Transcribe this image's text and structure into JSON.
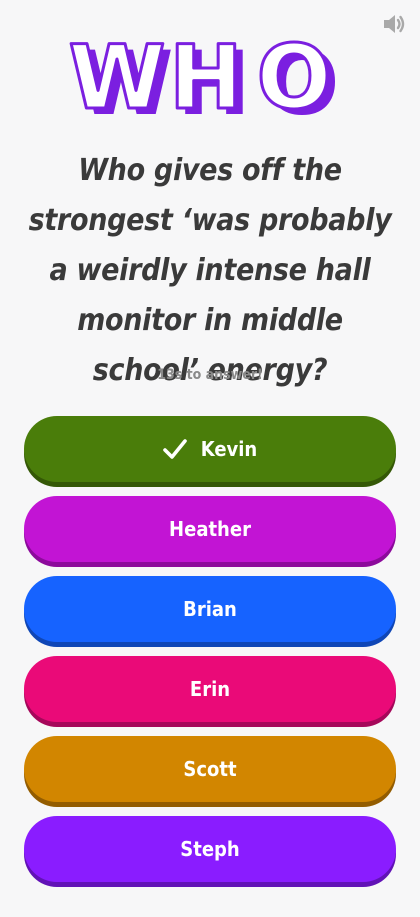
{
  "header": {
    "sound_icon": "speaker-icon",
    "logo_letters": [
      "W",
      "H",
      "O"
    ],
    "logo_colors": {
      "face": "#ffffff",
      "outline": "#7b1fe0",
      "shadow": "#7b1fe0"
    }
  },
  "question": {
    "text": "Who gives off the strongest ‘was probably a weirdly intense hall monitor in middle school’ energy?"
  },
  "timer": {
    "text": "13s to answer!"
  },
  "answers": [
    {
      "label": "Kevin",
      "color": "#4a7d0a",
      "selected": true,
      "icon": "check-icon"
    },
    {
      "label": "Heather",
      "color": "#c214d4",
      "selected": false
    },
    {
      "label": "Brian",
      "color": "#1663ff",
      "selected": false
    },
    {
      "label": "Erin",
      "color": "#ea0a78",
      "selected": false
    },
    {
      "label": "Scott",
      "color": "#d28600",
      "selected": false
    },
    {
      "label": "Steph",
      "color": "#8a1cff",
      "selected": false
    }
  ]
}
